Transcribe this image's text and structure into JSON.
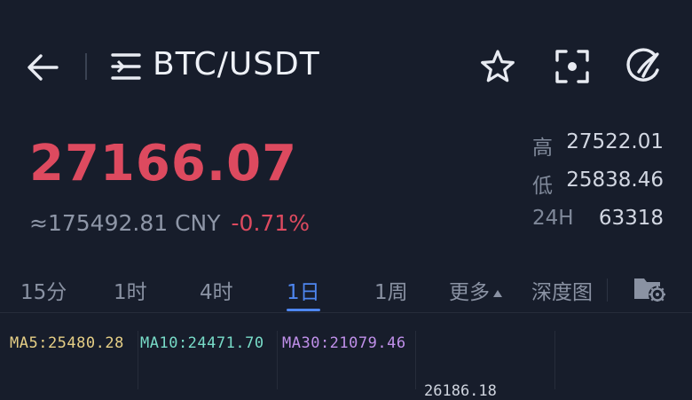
{
  "header": {
    "pair": "BTC/USDT",
    "icons": [
      "arrow-left-icon",
      "menu-lines-icon",
      "star-icon",
      "scan-icon",
      "refresh-icon"
    ]
  },
  "price": {
    "last": "27166.07",
    "cny": "≈175492.81 CNY",
    "change": "-0.71%"
  },
  "stats": [
    {
      "label": "高",
      "value": "27522.01"
    },
    {
      "label": "低",
      "value": "25838.46"
    },
    {
      "label": "24H",
      "value": "63318"
    }
  ],
  "tabs": {
    "m15": "15分",
    "h1": "1时",
    "h4": "4时",
    "d1": "1日",
    "w1": "1周",
    "more": "更多",
    "depth": "深度图"
  },
  "active_tab": "1日",
  "ma": {
    "ma5": "MA5:25480.28",
    "ma10": "MA10:24471.70",
    "ma30": "MA30:21079.46"
  },
  "chart": {
    "partial_label": "26186.18"
  },
  "colors": {
    "background": "#171d2b",
    "down": "#dd4a5f",
    "accent": "#4e86f0",
    "ma5": "#e6cf86",
    "ma10": "#78dcc8",
    "ma30": "#c090ea"
  }
}
